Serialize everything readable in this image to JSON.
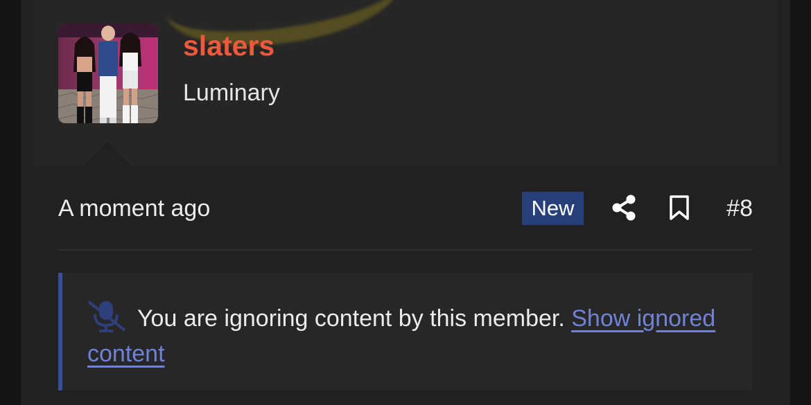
{
  "user": {
    "name": "slaters",
    "title": "Luminary",
    "name_color": "#f0583c"
  },
  "post": {
    "timestamp": "A moment ago",
    "badge": "New",
    "number": "#8",
    "icons": [
      "share-icon",
      "bookmark-icon"
    ]
  },
  "ignored": {
    "icon": "mute-icon",
    "message": "You are ignoring content by this member.",
    "link_text": "Show ignored content",
    "link_color": "#7183d4"
  },
  "colors": {
    "badge_bg": "#27407a",
    "accent_border": "#3a4f9a"
  }
}
